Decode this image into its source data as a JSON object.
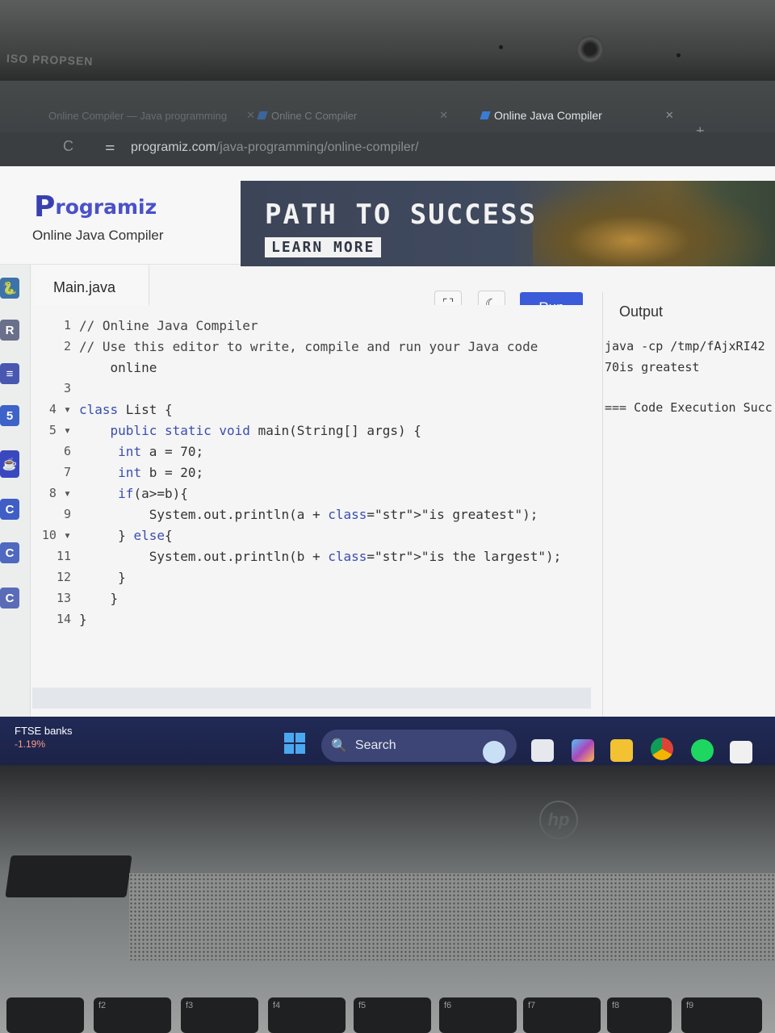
{
  "browser": {
    "tabs": [
      {
        "label": "Online Compiler — Java programming",
        "active": false
      },
      {
        "label": "Online C Compiler",
        "active": false
      },
      {
        "label": "Online Java Compiler",
        "active": true
      }
    ],
    "url_host": "programiz.com",
    "url_path": "/java-programming/online-compiler/"
  },
  "header": {
    "logo_text": "rogramiz",
    "logo_initial": "P",
    "subtitle": "Online Java Compiler"
  },
  "ad": {
    "title": "PATH TO SUCCESS",
    "button": "LEARN MORE"
  },
  "editor": {
    "file_tab": "Main.java",
    "run_label": "Run",
    "lines": [
      {
        "n": "1",
        "text": "// Online Java Compiler"
      },
      {
        "n": "2",
        "text": "// Use this editor to write, compile and run your Java code"
      },
      {
        "n": "",
        "text": "    online"
      },
      {
        "n": "3",
        "text": ""
      },
      {
        "n": "4 ▾",
        "text": "class List {"
      },
      {
        "n": "5 ▾",
        "text": "    public static void main(String[] args) {"
      },
      {
        "n": "6",
        "text": "     int a = 70;"
      },
      {
        "n": "7",
        "text": "     int b = 20;"
      },
      {
        "n": "8 ▾",
        "text": "     if(a>=b){"
      },
      {
        "n": "9",
        "text": "         System.out.println(a + \"is greatest\");"
      },
      {
        "n": "10 ▾",
        "text": "     } else{"
      },
      {
        "n": "11",
        "text": "         System.out.println(b + \"is the largest\");"
      },
      {
        "n": "12",
        "text": "     }"
      },
      {
        "n": "13",
        "text": "    }"
      },
      {
        "n": "14",
        "text": "}"
      }
    ]
  },
  "output": {
    "label": "Output",
    "lines": [
      "java -cp /tmp/fAjxRI42",
      "70is greatest",
      "",
      "=== Code Execution Succ"
    ]
  },
  "taskbar": {
    "ticker_name": "FTSE banks",
    "ticker_change": "-1.19%",
    "search_placeholder": "Search"
  },
  "laptop": {
    "brand": "hp",
    "bezel_text": "ISO PROPSEN",
    "keys": [
      "f2",
      "f3",
      "f4",
      "f5",
      "f6",
      "f7",
      "f8",
      "f9"
    ]
  },
  "colors": {
    "accent": "#3c5bd8",
    "logo": "#4a51c9",
    "taskbar": "#1e2650"
  }
}
